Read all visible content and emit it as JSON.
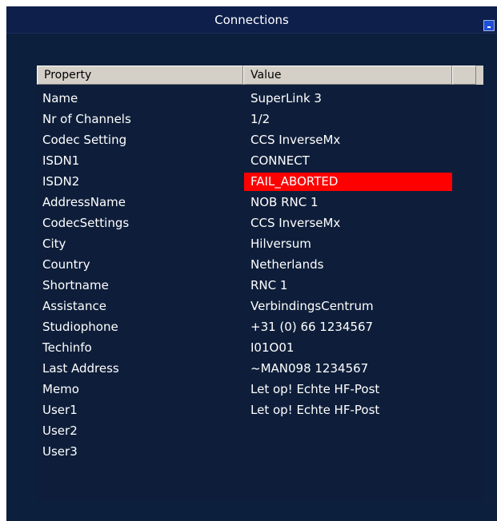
{
  "window": {
    "title": "Connections"
  },
  "table": {
    "columns": [
      "Property",
      "Value"
    ],
    "rows": [
      {
        "property": "Name",
        "value": "SuperLink 3"
      },
      {
        "property": "Nr of Channels",
        "value": "1/2"
      },
      {
        "property": "Codec Setting",
        "value": "CCS InverseMx"
      },
      {
        "property": "ISDN1",
        "value": "CONNECT"
      },
      {
        "property": "ISDN2",
        "value": "FAIL_ABORTED",
        "status_color": "#ff0000"
      },
      {
        "property": "AddressName",
        "value": "NOB RNC 1"
      },
      {
        "property": "CodecSettings",
        "value": "CCS InverseMx"
      },
      {
        "property": "City",
        "value": "Hilversum"
      },
      {
        "property": "Country",
        "value": "Netherlands"
      },
      {
        "property": "Shortname",
        "value": "RNC 1"
      },
      {
        "property": "Assistance",
        "value": "VerbindingsCentrum"
      },
      {
        "property": "Studiophone",
        "value": "+31 (0) 66 1234567"
      },
      {
        "property": "Techinfo",
        "value": "I01O01"
      },
      {
        "property": "Last Address",
        "value": "~MAN098 1234567"
      },
      {
        "property": "Memo",
        "value": "Let op! Echte HF-Post"
      },
      {
        "property": "User1",
        "value": "Let op! Echte HF-Post"
      },
      {
        "property": "User2",
        "value": ""
      },
      {
        "property": "User3",
        "value": ""
      }
    ]
  },
  "colors": {
    "window_bg": "#0c1f3c",
    "panel_bg": "#0e1e3a",
    "header_bg": "#d4d0c8",
    "alert": "#ff0000"
  }
}
